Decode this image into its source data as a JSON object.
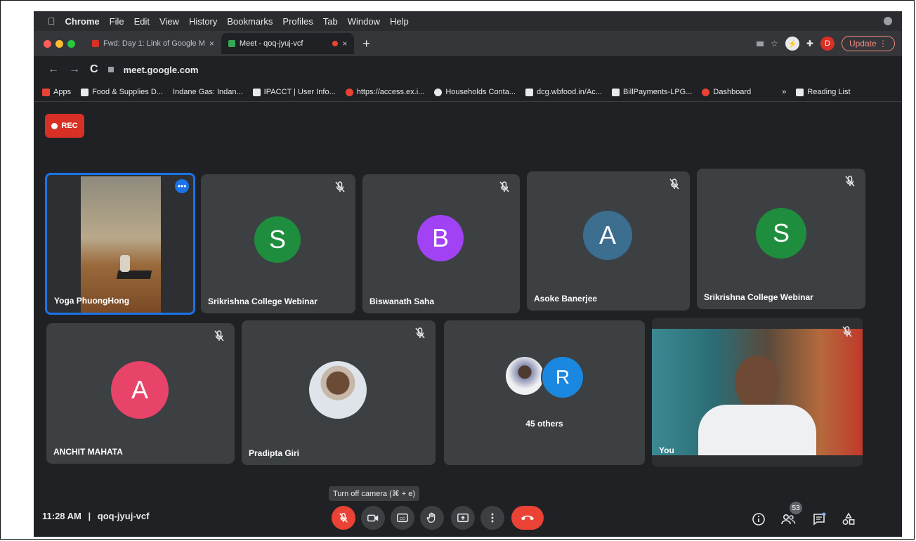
{
  "menubar": {
    "app_name": "Chrome",
    "items": [
      "File",
      "Edit",
      "View",
      "History",
      "Bookmarks",
      "Profiles",
      "Tab",
      "Window",
      "Help"
    ]
  },
  "tabs": [
    {
      "label": "Fwd: Day 1: Link of Google M",
      "close": "×"
    },
    {
      "label": "Meet - qoq-jyuj-vcf",
      "close": "×"
    }
  ],
  "toolbar": {
    "update_label": "Update",
    "profile_initial": "D",
    "new_tab": "+"
  },
  "omnibox": {
    "url": "meet.google.com"
  },
  "bookmarks": {
    "items": [
      "Apps",
      "Food & Supplies D...",
      "Indane Gas: Indan...",
      "IPACCT | User Info...",
      "https://access.ex.i...",
      "Households Conta...",
      "dcg.wbfood.in/Ac...",
      "BillPayments-LPG...",
      "Dashboard"
    ],
    "overflow": "»",
    "reading_list": "Reading List"
  },
  "meet": {
    "rec_label": "REC",
    "participants": [
      {
        "name": "Yoga PhuongHong"
      },
      {
        "name": "Srikrishna College Webinar",
        "initial": "S",
        "color": "#1e8e3e"
      },
      {
        "name": "Biswanath Saha",
        "initial": "B",
        "color": "#a142f4"
      },
      {
        "name": "Asoke Banerjee",
        "initial": "A",
        "color": "#3b6e8f"
      },
      {
        "name": "Srikrishna College Webinar",
        "initial": "S",
        "color": "#1e8e3e"
      },
      {
        "name": "ANCHIT MAHATA",
        "initial": "A",
        "color": "#e8446a"
      },
      {
        "name": "Pradipta Giri"
      },
      {
        "name": "45 others",
        "initial": "R",
        "color": "#1a88e0"
      },
      {
        "name": "You"
      }
    ],
    "more_icon": "•••",
    "time": "11:28 AM",
    "separator": "|",
    "meeting_code": "qoq-jyuj-vcf",
    "tooltip": "Turn off camera (⌘ + e)",
    "people_count": "53"
  }
}
